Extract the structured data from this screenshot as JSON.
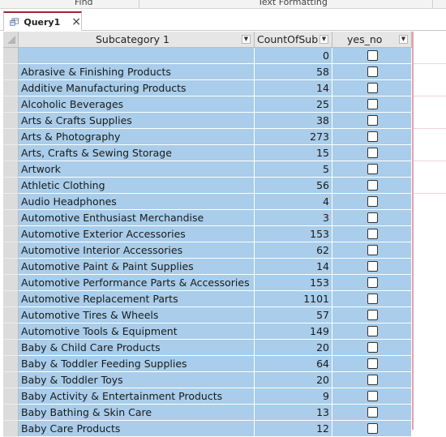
{
  "ribbon": {
    "groups": [
      "Find",
      "Text Formatting"
    ]
  },
  "tab": {
    "title": "Query1",
    "close": "×"
  },
  "columns": [
    {
      "label": "Subcategory 1"
    },
    {
      "label": "CountOfSub"
    },
    {
      "label": "yes_no"
    }
  ],
  "rows": [
    {
      "subcategory": "",
      "count": "0"
    },
    {
      "subcategory": "Abrasive & Finishing Products",
      "count": "58"
    },
    {
      "subcategory": "Additive Manufacturing Products",
      "count": "14"
    },
    {
      "subcategory": "Alcoholic Beverages",
      "count": "25"
    },
    {
      "subcategory": "Arts & Crafts Supplies",
      "count": "38"
    },
    {
      "subcategory": "Arts & Photography",
      "count": "273"
    },
    {
      "subcategory": "Arts, Crafts & Sewing Storage",
      "count": "15"
    },
    {
      "subcategory": "Artwork",
      "count": "5"
    },
    {
      "subcategory": "Athletic Clothing",
      "count": "56"
    },
    {
      "subcategory": "Audio Headphones",
      "count": "4"
    },
    {
      "subcategory": "Automotive Enthusiast Merchandise",
      "count": "3"
    },
    {
      "subcategory": "Automotive Exterior Accessories",
      "count": "153"
    },
    {
      "subcategory": "Automotive Interior Accessories",
      "count": "62"
    },
    {
      "subcategory": "Automotive Paint & Paint Supplies",
      "count": "14"
    },
    {
      "subcategory": "Automotive Performance Parts & Accessories",
      "count": "153"
    },
    {
      "subcategory": "Automotive Replacement Parts",
      "count": "1101"
    },
    {
      "subcategory": "Automotive Tires & Wheels",
      "count": "57"
    },
    {
      "subcategory": "Automotive Tools & Equipment",
      "count": "149"
    },
    {
      "subcategory": "Baby & Child Care Products",
      "count": "20"
    },
    {
      "subcategory": "Baby & Toddler Feeding  Supplies",
      "count": "64"
    },
    {
      "subcategory": "Baby & Toddler Toys",
      "count": "20"
    },
    {
      "subcategory": "Baby Activity & Entertainment Products",
      "count": "9"
    },
    {
      "subcategory": "Baby Bathing & Skin Care",
      "count": "13"
    },
    {
      "subcategory": "Baby Care Products",
      "count": "12"
    }
  ],
  "colors": {
    "cell_bg": "#a9cdea",
    "tab_accent": "#a4262c",
    "pane_border": "#e8a0a8"
  }
}
